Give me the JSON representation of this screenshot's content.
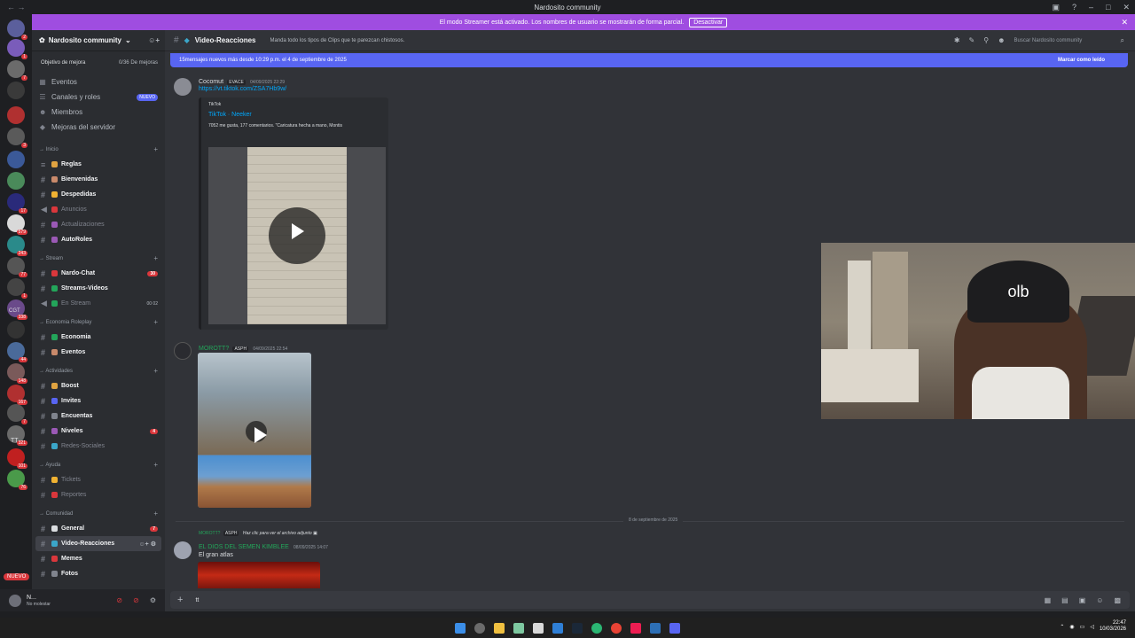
{
  "app": {
    "title": "Nardosito community"
  },
  "banner": {
    "text": "El modo Streamer está activado. Los nombres de usuario se mostrarán de forma parcial.",
    "button": "Desactivar"
  },
  "guilds": [
    {
      "badge": "2"
    },
    {
      "badge": "1"
    },
    {
      "badge": "7"
    },
    {
      "badge": ""
    },
    {
      "badge": ""
    },
    {
      "badge": "3"
    },
    {
      "badge": ""
    },
    {
      "badge": ""
    },
    {
      "badge": "17"
    },
    {
      "badge": "579"
    },
    {
      "badge": "243"
    },
    {
      "badge": "77"
    },
    {
      "badge": "1"
    },
    {
      "badge": "338"
    },
    {
      "badge": ""
    },
    {
      "badge": "44"
    },
    {
      "badge": "148"
    },
    {
      "badge": "167"
    },
    {
      "badge": "7"
    },
    {
      "badge": "321"
    },
    {
      "badge": "101"
    },
    {
      "badge": "76"
    }
  ],
  "guild_labels": {
    "cgt": "CGT",
    "tt": "TT",
    "new": "NUEVO"
  },
  "server": {
    "name": "Nardosito community",
    "boost_goal": "Objetivo de mejora",
    "boost_progress": "0/36 De mejoras",
    "nav": [
      {
        "label": "Eventos",
        "icon": "calendar-icon",
        "glyph": "▦"
      },
      {
        "label": "Canales y roles",
        "icon": "list-icon",
        "glyph": "☰",
        "pill": "NUEVO"
      },
      {
        "label": "Miembros",
        "icon": "members-icon",
        "glyph": "☻"
      },
      {
        "label": "Mejoras del servidor",
        "icon": "boost-icon",
        "glyph": "◆"
      }
    ]
  },
  "categories": [
    {
      "name": "→ Inicio",
      "channels": [
        {
          "name": "Reglas",
          "color": "#e0a341",
          "icon": "≡"
        },
        {
          "name": "Bienvenidas",
          "color": "#c98a6b",
          "icon": "#"
        },
        {
          "name": "Despedidas",
          "color": "#f0b232",
          "icon": "#"
        },
        {
          "name": "Anuncios",
          "color": "#da373c",
          "icon": "◀",
          "muted": true
        },
        {
          "name": "Actualizaciones",
          "color": "#9b59b6",
          "icon": "#",
          "muted": true
        },
        {
          "name": "AutoRoles",
          "color": "#9b59b6",
          "icon": "#"
        }
      ]
    },
    {
      "name": "→ Stream",
      "channels": [
        {
          "name": "Nardo-Chat",
          "color": "#da373c",
          "icon": "#",
          "badge": "30"
        },
        {
          "name": "Streams-Videos",
          "color": "#23a55a",
          "icon": "#"
        },
        {
          "name": "En Stream",
          "color": "#23a55a",
          "icon": "◀",
          "muted": true,
          "counts": "00 02"
        }
      ]
    },
    {
      "name": "→ Economia Roleplay",
      "channels": [
        {
          "name": "Economia",
          "color": "#23a55a",
          "icon": "#"
        },
        {
          "name": "Eventos",
          "color": "#c98a6b",
          "icon": "#"
        }
      ]
    },
    {
      "name": "→ Actividades",
      "channels": [
        {
          "name": "Boost",
          "color": "#e0a341",
          "icon": "#"
        },
        {
          "name": "Invites",
          "color": "#5865f2",
          "icon": "#"
        },
        {
          "name": "Encuentas",
          "color": "#80848e",
          "icon": "#"
        },
        {
          "name": "Niveles",
          "color": "#9b59b6",
          "icon": "#",
          "badge": "4"
        },
        {
          "name": "Redes-Sociales",
          "color": "#3ba6c9",
          "icon": "#",
          "muted": true
        }
      ]
    },
    {
      "name": "→ Ayuda",
      "channels": [
        {
          "name": "Tickets",
          "color": "#f0b232",
          "icon": "#",
          "muted": true
        },
        {
          "name": "Reportes",
          "color": "#da373c",
          "icon": "#",
          "muted": true
        }
      ]
    },
    {
      "name": "→ Comunidad",
      "channels": [
        {
          "name": "General",
          "color": "#dbdee1",
          "icon": "#",
          "badge": "7"
        },
        {
          "name": "Video-Reacciones",
          "color": "#3ba6c9",
          "icon": "#",
          "active": true
        },
        {
          "name": "Memes",
          "color": "#da373c",
          "icon": "#"
        },
        {
          "name": "Fotos",
          "color": "#80848e",
          "icon": "#"
        }
      ]
    }
  ],
  "user": {
    "name": "N...",
    "status": "No molestar"
  },
  "channel": {
    "name": "Video-Reacciones",
    "topic": "Manda todo los tipos de Clips que te parezcan chistosos.",
    "search_placeholder": "Buscar Nardosito community"
  },
  "new_messages": {
    "text": "15mensajes nuevos más desde 10:29 p.m. el 4 de septiembre de 2025",
    "action": "Marcar como leído"
  },
  "messages": [
    {
      "author": "Cocomut",
      "author_color": "#dbdee1",
      "tag": "EVACE",
      "timestamp": "04/09/2025 22:29",
      "link": "https://vt.tiktok.com/ZSA7Hb9w/",
      "embed": {
        "provider": "TikTok",
        "title": "TikTok · Neeker",
        "description": "7052 me gusta, 177 comentarios. \"Caricatura hecha a mano, Montis"
      }
    },
    {
      "author": "MOROTT?",
      "author_color": "#23a55a",
      "tag": "ASPH",
      "timestamp": "04/09/2025 22:54"
    },
    {
      "reply_author": "MOROTT?",
      "reply_tag": "ASPH",
      "reply_text": "Haz clic para ver el archivo adjunto",
      "author": "EL DIOS DEL SEMEN KIMBLEE",
      "author_color": "#23a55a",
      "timestamp": "08/09/2025 14:07",
      "text": "El gran atlas"
    }
  ],
  "date_divider": "8 de septiembre de 2025",
  "composer": {
    "value": "tt"
  },
  "clock": {
    "time": "22:47",
    "date": "10/03/2026"
  }
}
